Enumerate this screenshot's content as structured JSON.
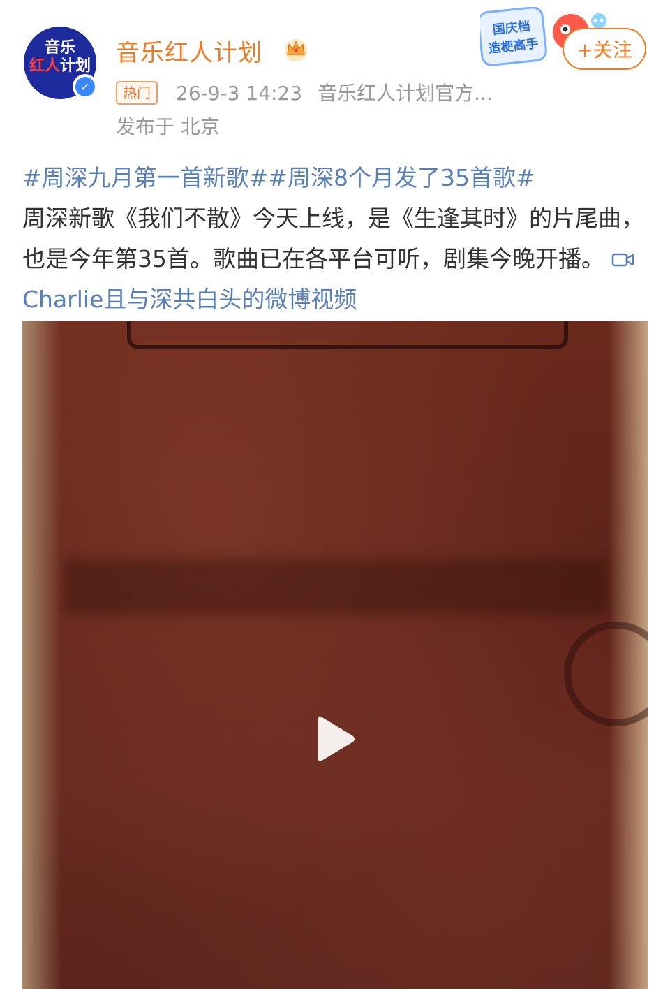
{
  "post": {
    "username": "音乐红人计划",
    "avatar_text_line1": "音乐",
    "avatar_text_line2_red": "红人",
    "avatar_text_line2_white": "计划",
    "badge": "热门",
    "timestamp": "26-9-3 14:23",
    "source": "音乐红人计划官方...",
    "location": "发布于 北京",
    "promo_text_line1": "国庆档",
    "promo_text_line2": "造梗高手",
    "follow_label": "+关注",
    "hashtag1": "#周深九月第一首新歌#",
    "hashtag2": "#周深8个月发了35首歌#",
    "body": "周深新歌《我们不散》今天上线，是《生逢其时》的片尾曲，也是今年第35首。歌曲已在各平台可听，剧集今晚开播。",
    "video_link": "Charlie且与深共白头的微博视频"
  },
  "colors": {
    "brand_orange": "#ef7b22",
    "link_blue": "#5a80b8",
    "meta_gray": "#999999"
  },
  "icons": {
    "crown": "crown-icon",
    "verified": "verified-icon",
    "video": "video-camera-icon",
    "play": "play-icon"
  }
}
